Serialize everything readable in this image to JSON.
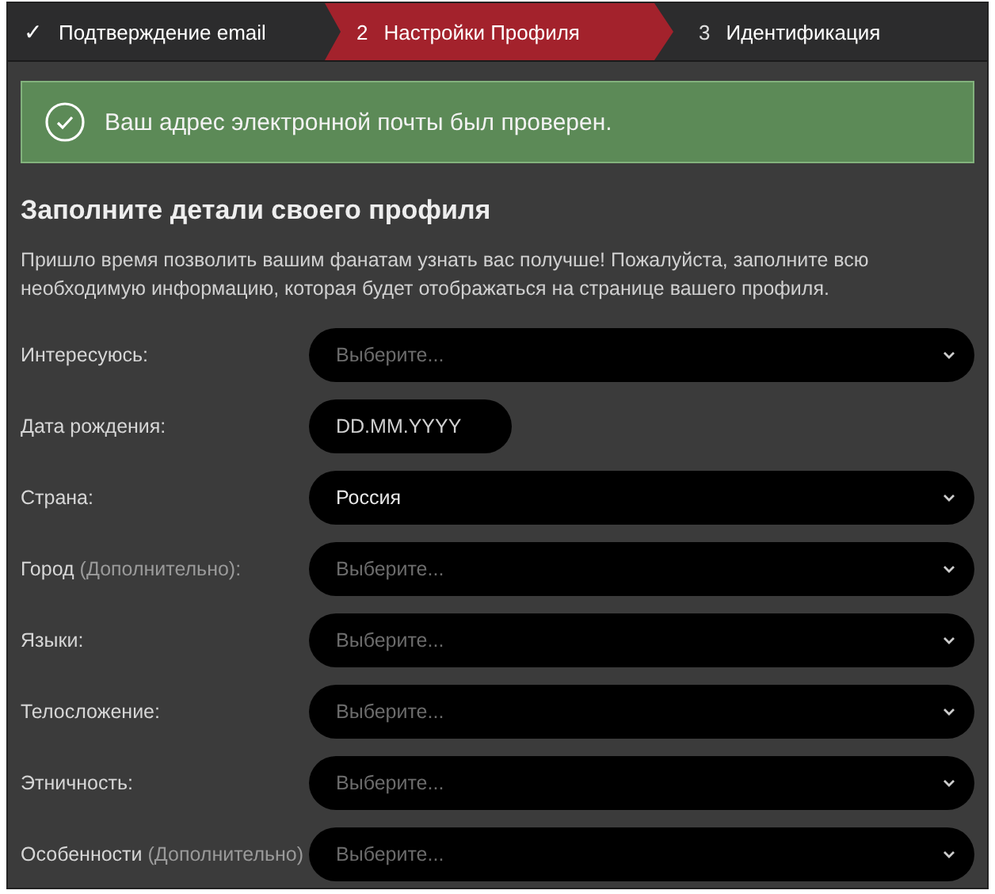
{
  "steps": [
    {
      "number": "✓",
      "label": "Подтверждение email",
      "done": true,
      "selected": false
    },
    {
      "number": "2",
      "label": "Настройки Профиля",
      "done": false,
      "selected": true
    },
    {
      "number": "3",
      "label": "Идентификация",
      "done": false,
      "selected": false
    }
  ],
  "alert": {
    "text": "Ваш адрес электронной почты был проверен."
  },
  "heading": "Заполните детали своего профиля",
  "intro": "Пришло время позволить вашим фанатам узнать вас получше! Пожалуйста, заполните всю необходимую информацию, которая будет отображаться на странице вашего профиля.",
  "fields": [
    {
      "label": "Интересуюсь:",
      "kind": "select",
      "placeholder": "Выберите..."
    },
    {
      "label": "Дата рождения:",
      "kind": "date",
      "placeholder": "DD.MM.YYYY"
    },
    {
      "label": "Страна:",
      "kind": "select",
      "value": "Россия"
    },
    {
      "label": "Город",
      "optional": "(Дополнительно):",
      "kind": "select",
      "placeholder": "Выберите..."
    },
    {
      "label": "Языки:",
      "kind": "select",
      "placeholder": "Выберите..."
    },
    {
      "label": "Телосложение:",
      "kind": "select",
      "placeholder": "Выберите..."
    },
    {
      "label": "Этничность:",
      "kind": "select",
      "placeholder": "Выберите..."
    },
    {
      "label": "Особенности",
      "optional": "(Дополнительно)",
      "kind": "select",
      "placeholder": "Выберите..."
    }
  ]
}
